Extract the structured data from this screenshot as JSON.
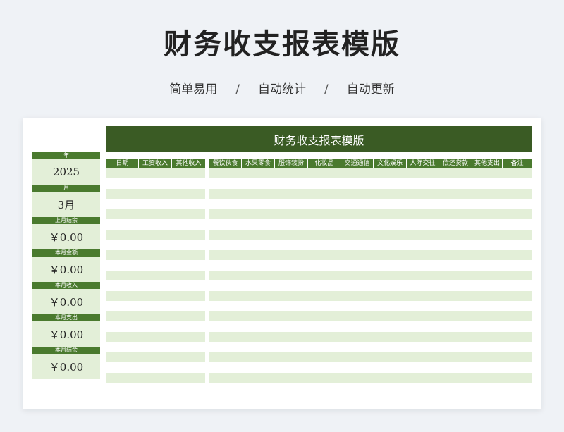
{
  "header": {
    "title": "财务收支报表模版",
    "features": [
      "简单易用",
      "自动统计",
      "自动更新"
    ],
    "separator": "/"
  },
  "sheet": {
    "banner_title": "财务收支报表模版",
    "summary": [
      {
        "label": "年",
        "value": "2025"
      },
      {
        "label": "月",
        "value": "3月"
      },
      {
        "label": "上月结余",
        "value": "￥0.00"
      },
      {
        "label": "本月金额",
        "value": "￥0.00"
      },
      {
        "label": "本月收入",
        "value": "￥0.00"
      },
      {
        "label": "本月支出",
        "value": "￥0.00"
      },
      {
        "label": "本月结余",
        "value": "￥0.00"
      }
    ],
    "income_columns": [
      "日期",
      "工资收入",
      "其他收入"
    ],
    "expense_columns": [
      "餐饮伙食",
      "水果零食",
      "服饰装扮",
      "化妆品",
      "交通通信",
      "文化娱乐",
      "人际交往",
      "偿还贷款",
      "其他支出",
      "备注"
    ],
    "row_count": 22
  },
  "colors": {
    "dark_green": "#3a5b24",
    "header_green": "#4a7a2e",
    "light_green": "#e3efd8"
  }
}
